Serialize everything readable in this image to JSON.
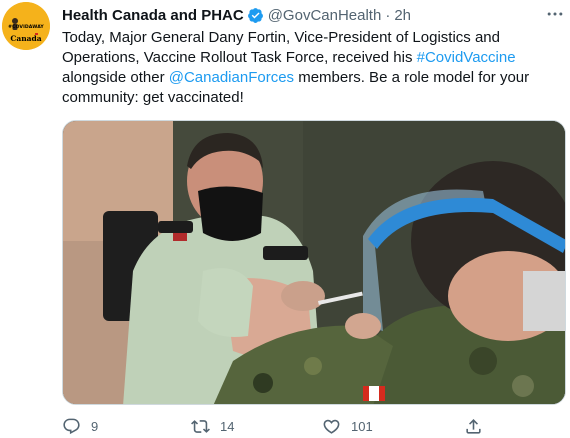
{
  "account": {
    "display_name": "Health Canada and PHAC",
    "handle": "@GovCanHealth",
    "separator": "·",
    "time": "2h",
    "verified": true,
    "avatar": {
      "hashtag": "#COVIDAWAY",
      "wordmark": "Canada",
      "color": "#f5b21b"
    }
  },
  "tweet": {
    "line1": "Today, Major General Dany Fortin, Vice-President of Logistics and",
    "line2": "Operations, Vaccine Rollout Task Force, received his ",
    "hashtag": "#CovidVaccine",
    "line3_start": "alongside other ",
    "mention": "@CanadianForces",
    "line3_end": " members. Be a role model for your",
    "line4": "community: get vaccinated!"
  },
  "actions": {
    "reply_count": "9",
    "retweet_count": "14",
    "like_count": "101"
  },
  "colors": {
    "link": "#1d9bf0",
    "secondary_text": "#536471",
    "verified": "#1d9bf0"
  },
  "icons": [
    "verified-badge-icon",
    "more-options-icon",
    "reply-icon",
    "retweet-icon",
    "like-icon",
    "share-icon"
  ]
}
